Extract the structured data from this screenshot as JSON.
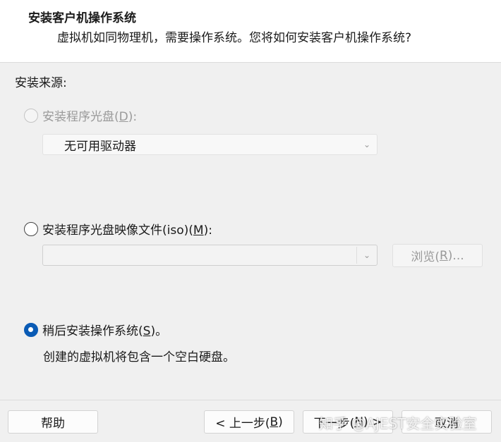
{
  "header": {
    "title": "安装客户机操作系统",
    "subtitle": "虚拟机如同物理机，需要操作系统。您将如何安装客户机操作系统?"
  },
  "source_label": "安装来源:",
  "options": {
    "disc": {
      "label": "安装程序光盘(",
      "key": "D",
      "suffix": "):",
      "drive_value": "无可用驱动器"
    },
    "iso": {
      "label": "安装程序光盘映像文件(iso)(",
      "key": "M",
      "suffix": "):",
      "path_value": "",
      "browse_label": "浏览(",
      "browse_key": "R",
      "browse_suffix": ")..."
    },
    "later": {
      "label": "稍后安装操作系统(",
      "key": "S",
      "suffix": ")。",
      "note": "创建的虚拟机将包含一个空白硬盘。"
    }
  },
  "footer": {
    "help": "帮助",
    "back_prefix": "< 上一步(",
    "back_key": "B",
    "back_suffix": ")",
    "next_prefix": "下一步(",
    "next_key": "N",
    "next_suffix": ") >",
    "cancel": "取消"
  },
  "watermark": "知乎 @AJEST安全实验室",
  "colors": {
    "accent": "#0a5bb5"
  }
}
